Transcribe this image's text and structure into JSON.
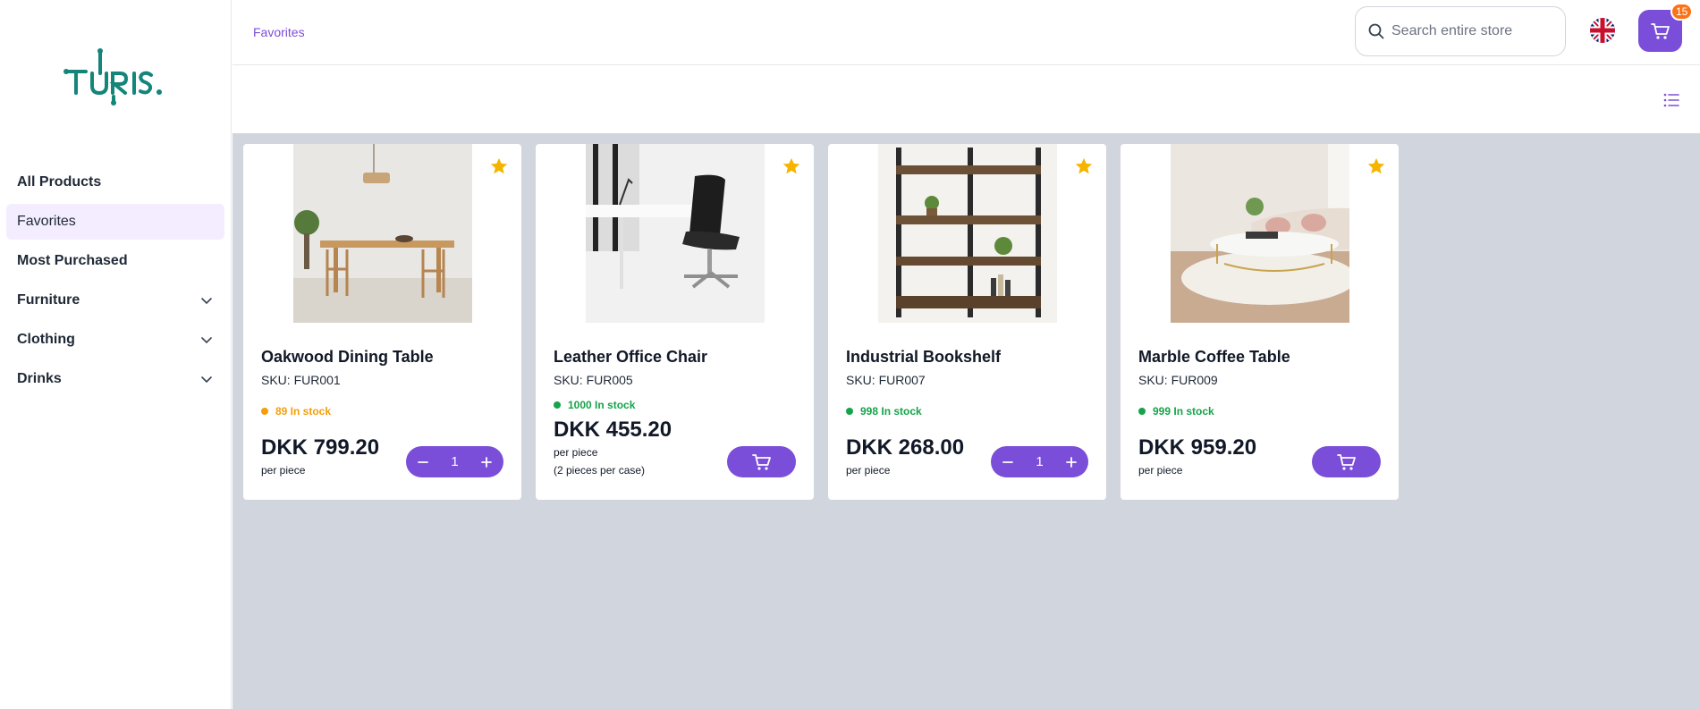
{
  "brand": {
    "logo_text": "TURIS.",
    "color": "#14857a"
  },
  "accent": "#7b4ed9",
  "sidebar": {
    "items": [
      {
        "label": "All Products",
        "expandable": false,
        "active": false
      },
      {
        "label": "Favorites",
        "expandable": false,
        "active": true
      },
      {
        "label": "Most Purchased",
        "expandable": false,
        "active": false
      },
      {
        "label": "Furniture",
        "expandable": true,
        "active": false
      },
      {
        "label": "Clothing",
        "expandable": true,
        "active": false
      },
      {
        "label": "Drinks",
        "expandable": true,
        "active": false
      }
    ]
  },
  "header": {
    "breadcrumb": "Favorites",
    "search_placeholder": "Search entire store",
    "cart_count": "15",
    "language_icon": "uk-flag-icon"
  },
  "products": [
    {
      "name": "Oakwood Dining Table",
      "sku": "SKU: FUR001",
      "stock": "89 In stock",
      "stock_color": "#f59e0b",
      "price": "DKK 799.20",
      "unit": "per piece",
      "unit_note": "",
      "quantity": "1",
      "control": "stepper"
    },
    {
      "name": "Leather Office Chair",
      "sku": "SKU: FUR005",
      "stock": "1000 In stock",
      "stock_color": "#16a34a",
      "price": "DKK 455.20",
      "unit": "per piece",
      "unit_note": "(2 pieces per case)",
      "quantity": "",
      "control": "cart"
    },
    {
      "name": "Industrial Bookshelf",
      "sku": "SKU: FUR007",
      "stock": "998 In stock",
      "stock_color": "#16a34a",
      "price": "DKK 268.00",
      "unit": "per piece",
      "unit_note": "",
      "quantity": "1",
      "control": "stepper"
    },
    {
      "name": "Marble Coffee Table",
      "sku": "SKU: FUR009",
      "stock": "999 In stock",
      "stock_color": "#16a34a",
      "price": "DKK 959.20",
      "unit": "per piece",
      "unit_note": "",
      "quantity": "",
      "control": "cart"
    }
  ]
}
